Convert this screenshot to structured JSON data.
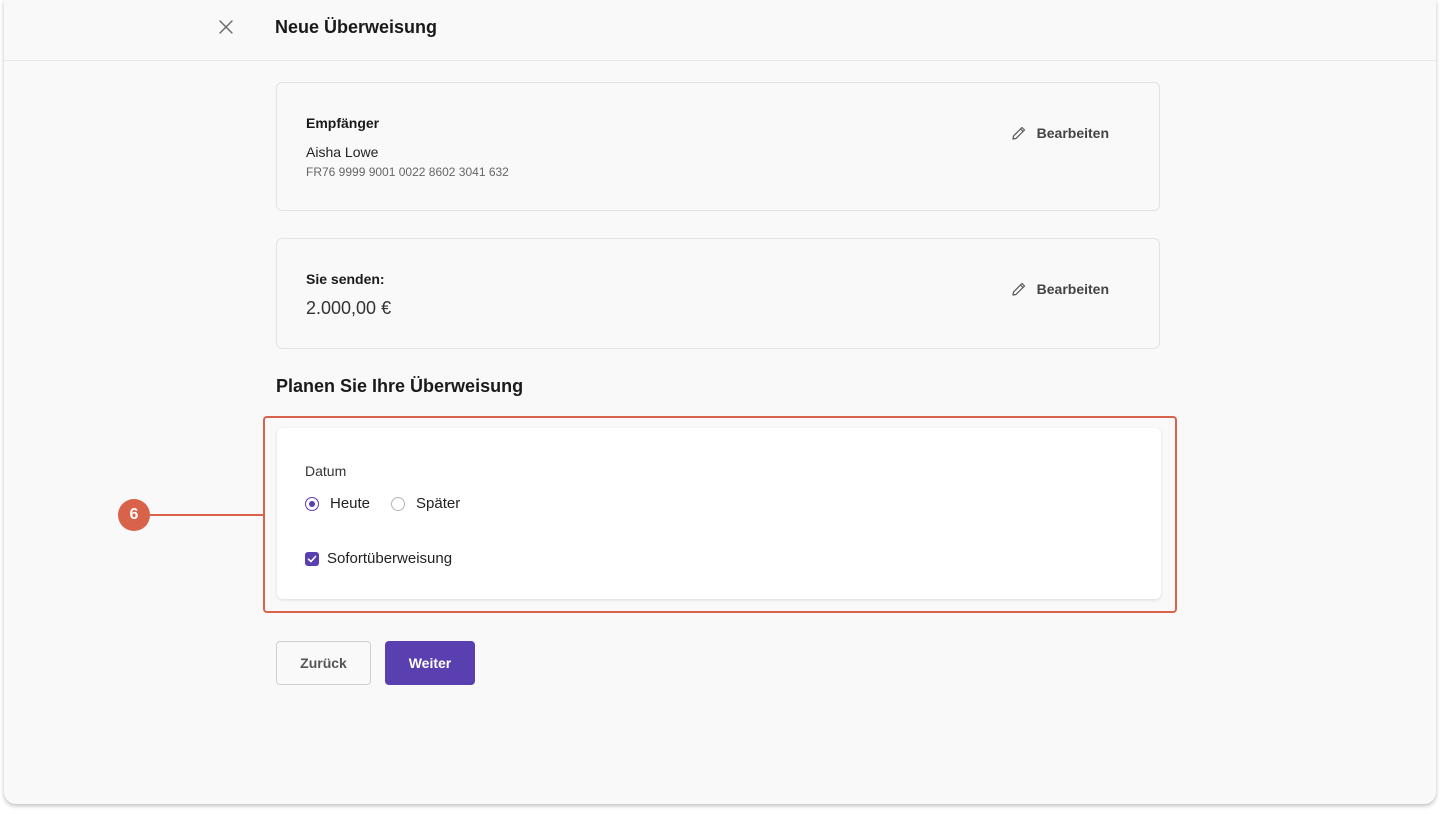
{
  "header": {
    "close_icon": "close-icon",
    "title": "Neue Überweisung"
  },
  "recipient": {
    "label": "Empfänger",
    "name": "Aisha Lowe",
    "iban": "FR76 9999 9001 0022 8602 3041 632",
    "edit_label": "Bearbeiten",
    "edit_icon": "pencil-icon"
  },
  "amount": {
    "label": "Sie senden:",
    "value": "2.000,00 €",
    "edit_label": "Bearbeiten",
    "edit_icon": "pencil-icon"
  },
  "schedule": {
    "title": "Planen Sie Ihre Überweisung",
    "date_label": "Datum",
    "options": [
      {
        "label": "Heute",
        "checked": true
      },
      {
        "label": "Später",
        "checked": false
      }
    ],
    "instant_label": "Sofortüberweisung",
    "instant_checked": true
  },
  "callout": {
    "number": "6",
    "color": "#d9624a"
  },
  "actions": {
    "back_label": "Zurück",
    "next_label": "Weiter"
  },
  "colors": {
    "accent": "#5a3fb0",
    "highlight": "#d9624a"
  }
}
